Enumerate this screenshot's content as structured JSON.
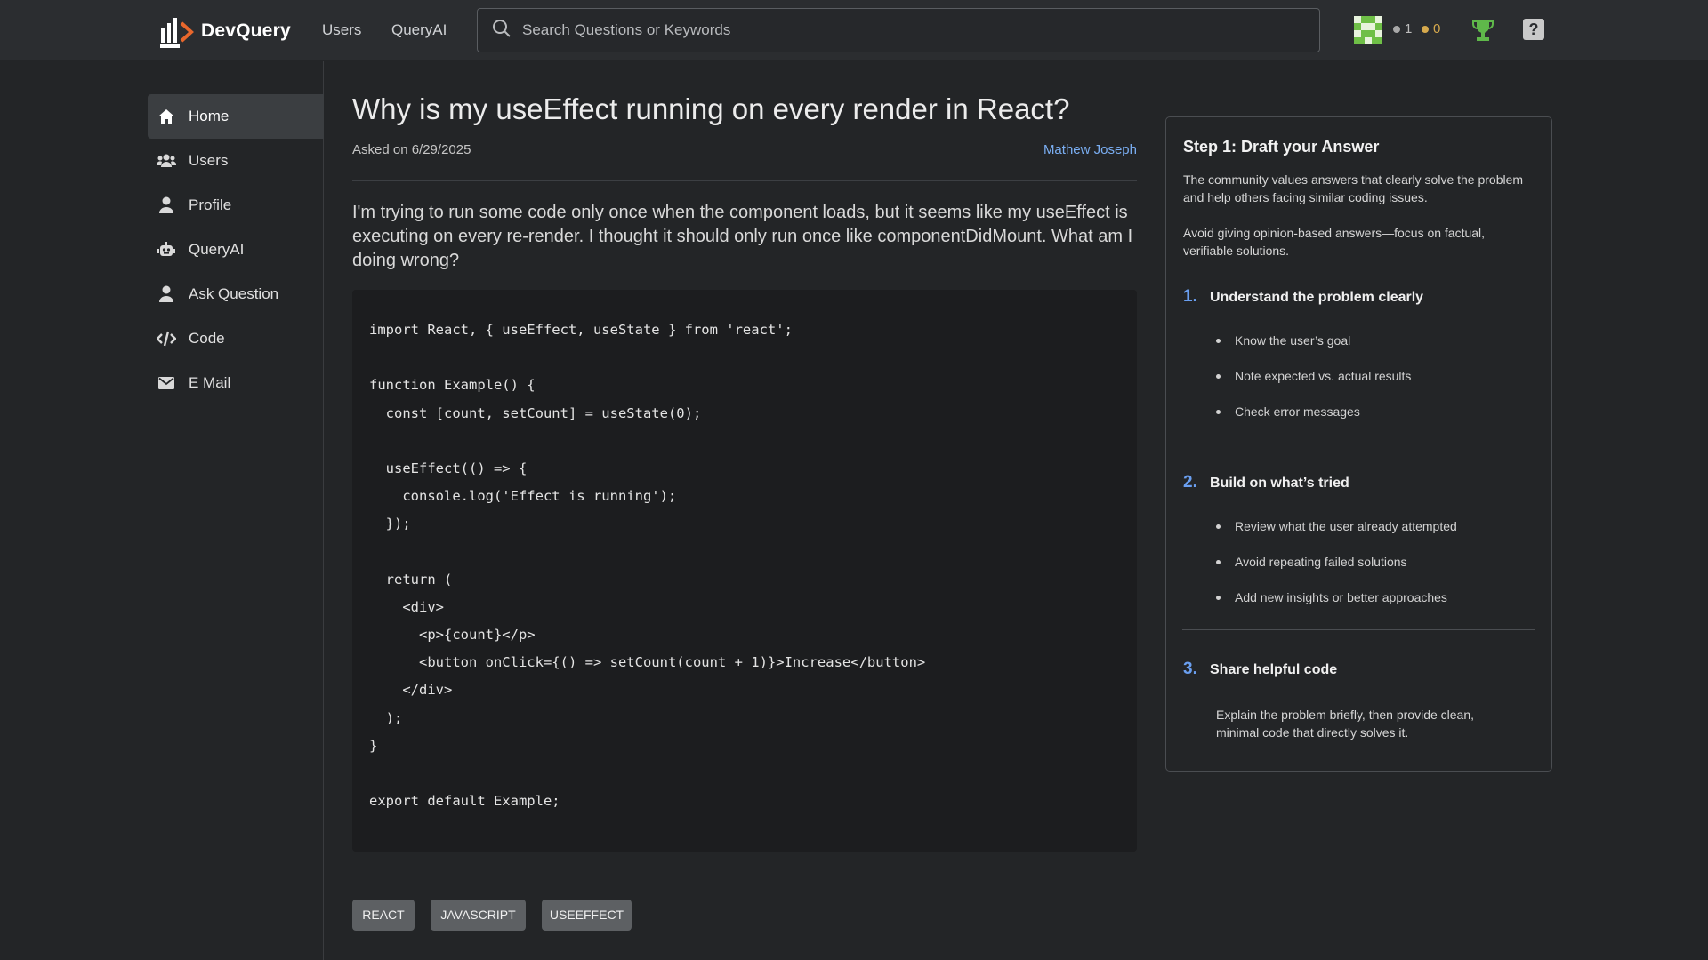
{
  "app": {
    "name": "DevQuery"
  },
  "topnav": {
    "users": "Users",
    "queryai": "QueryAI"
  },
  "search": {
    "placeholder": "Search Questions or Keywords"
  },
  "user_badges": {
    "silver": "1",
    "gold": "0"
  },
  "help_label": "?",
  "sidebar": {
    "items": [
      {
        "label": "Home",
        "icon": "home-icon"
      },
      {
        "label": "Users",
        "icon": "users-icon"
      },
      {
        "label": "Profile",
        "icon": "profile-icon"
      },
      {
        "label": "QueryAI",
        "icon": "robot-icon"
      },
      {
        "label": "Ask Question",
        "icon": "user-icon"
      },
      {
        "label": "Code",
        "icon": "code-icon"
      },
      {
        "label": "E Mail",
        "icon": "mail-icon"
      }
    ]
  },
  "question": {
    "title": "Why is my useEffect running on every render in React?",
    "asked": "Asked on 6/29/2025",
    "author": "Mathew Joseph",
    "body": "I'm trying to run some code only once when the component loads, but it seems like my useEffect is executing on every re-render. I thought it should only run once like componentDidMount. What am I doing wrong?",
    "code": [
      "import React, { useEffect, useState } from 'react';",
      "",
      "function Example() {",
      "  const [count, setCount] = useState(0);",
      "",
      "  useEffect(() => {",
      "    console.log('Effect is running');",
      "  });",
      "",
      "  return (",
      "    <div>",
      "      <p>{count}</p>",
      "      <button onClick={() => setCount(count + 1)}>Increase</button>",
      "    </div>",
      "  );",
      "}",
      "",
      "export default Example;"
    ],
    "tags": [
      "REACT",
      "JAVASCRIPT",
      "USEEFFECT"
    ]
  },
  "guide": {
    "heading": "Step 1: Draft your Answer",
    "intro1": "The community values answers that clearly solve the problem and help others facing similar coding issues.",
    "intro2": "Avoid giving opinion-based answers—focus on factual, verifiable solutions.",
    "steps": [
      {
        "num": "1.",
        "title": "Understand the problem clearly",
        "bullets": [
          "Know the user’s goal",
          "Note expected vs. actual results",
          "Check error messages"
        ]
      },
      {
        "num": "2.",
        "title": "Build on what’s tried",
        "bullets": [
          "Review what the user already attempted",
          "Avoid repeating failed solutions",
          "Add new insights or better approaches"
        ]
      },
      {
        "num": "3.",
        "title": "Share helpful code",
        "text": "Explain the problem briefly, then provide clean, minimal code that directly solves it."
      }
    ]
  },
  "colors": {
    "accent": "#6a9ff0",
    "link": "#7aaef2",
    "logo_orange": "#e8672c",
    "trophy": "#5fb84a",
    "avatar": "#6fbf47"
  }
}
